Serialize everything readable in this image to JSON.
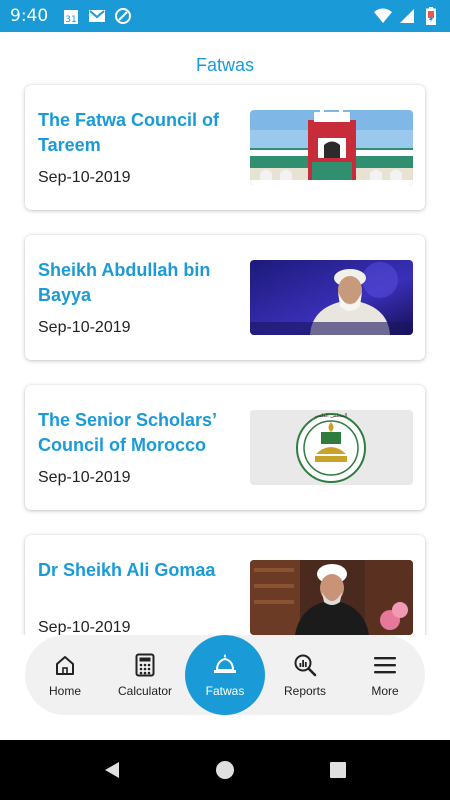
{
  "status_bar": {
    "time": "9:40",
    "calendar_day": "31"
  },
  "header": {
    "title": "Fatwas"
  },
  "fatwas": [
    {
      "title": "The Fatwa Council of Tareem",
      "date": "Sep-10-2019",
      "thumb": "building"
    },
    {
      "title": "Sheikh Abdullah bin Bayya",
      "date": "Sep-10-2019",
      "thumb": "portrait-studio"
    },
    {
      "title": "The Senior Scholars’ Council of Morocco",
      "date": "Sep-10-2019",
      "thumb": "emblem"
    },
    {
      "title": "Dr Sheikh Ali Gomaa",
      "date": "Sep-10-2019",
      "thumb": "portrait-library"
    }
  ],
  "nav": {
    "items": [
      {
        "label": "Home",
        "icon": "home-icon"
      },
      {
        "label": "Calculator",
        "icon": "calculator-icon"
      },
      {
        "label": "Fatwas",
        "icon": "mosque-icon",
        "active": true
      },
      {
        "label": "Reports",
        "icon": "reports-search-icon"
      },
      {
        "label": "More",
        "icon": "menu-icon"
      }
    ]
  },
  "colors": {
    "accent": "#1a9bd7",
    "nav_bg": "#f1f1f1"
  }
}
